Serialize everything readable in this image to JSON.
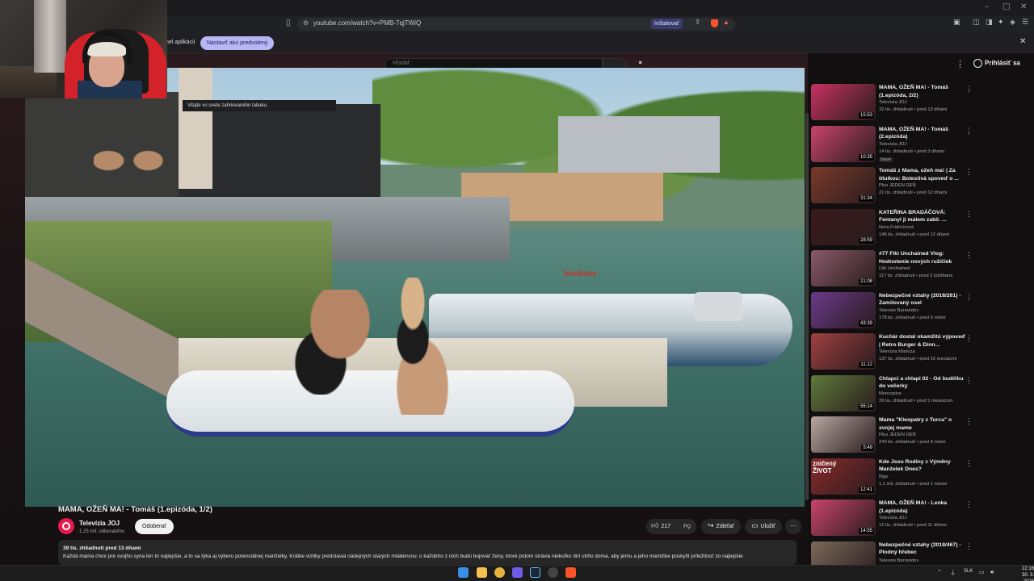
{
  "browser": {
    "url": "youtube.com/watch?v=PMB-7qjTWiQ",
    "install_label": "Inštalovať",
    "infobar_text": "nel aplikácií",
    "default_button": "Nastaviť ako predvolený",
    "close_glyph": "✕"
  },
  "youtube": {
    "search_placeholder": "Hľadať",
    "signin_label": "Prihlásiť sa"
  },
  "video": {
    "sign_text": "Vitajte vo svete zahrievaného tabaku.",
    "boat_text": "honkave",
    "title": "MAMA, OŽEŇ MA! - Tomáš (1.epizóda, 1/2)",
    "channel": "Televízia JOJ",
    "subscribers": "1,25 mil. odberateľov",
    "subscribe_label": "Odoberať",
    "likes": "217",
    "share_label": "Zdieľať",
    "save_label": "Uložiť",
    "stats": "39 tis. zhliadnutí  pred 13 dňami",
    "description": "Každá mama chce pre svojho syna len to najlepšie, a to sa týka aj výberu potenciálnej manželky. Krátke vizitky predstavia nádejných starých mládencov, o každého z nich budú bojovať ženy, ktoré potom strávia niekoľko dní uhňo doma, aby jemu a jeho mamičke poskytli príležitosť zo najlepšie"
  },
  "sidebar": {
    "items": [
      {
        "title": "MAMA, OŽEŇ MA! - Tomáš (1.epizóda, 2/2)",
        "channel": "Televízia JOJ",
        "meta": "32 tis. zhliadnutí • pred 13 dňami",
        "duration": "15:53",
        "badge": "",
        "thumb": "#c83262"
      },
      {
        "title": "MAMA, OŽEŇ MA! - Tomáš (2.epizóda)",
        "channel": "Televízia JOJ",
        "meta": "14 tis. zhliadnutí • pred 3 dňami",
        "duration": "10:35",
        "badge": "Nové",
        "thumb": "#c9446c"
      },
      {
        "title": "Tomáš z Mama, ožeň ma! | Za titulkou: Bolestivá spoveď o ...",
        "channel": "Plus JEDEN DEŇ",
        "meta": "21 tis. zhliadnutí • pred 12 dňami",
        "duration": "31:34",
        "badge": "",
        "thumb": "#7a3a2a"
      },
      {
        "title": "KATEŘINA BRADÁČOVÁ: Fentanyl ji málem zabil. ...",
        "channel": "Nora Fridrichová",
        "meta": "146 tis. zhliadnutí • pred 12 dňami",
        "duration": "28:59",
        "badge": "",
        "thumb": "#3a1a1a"
      },
      {
        "title": "#77 Fiki Unchained Vlog: Hodnotenie nových ružičiek",
        "channel": "Fiki Unchained",
        "meta": "117 tis. zhliadnutí • pred 2 týždňami",
        "duration": "21:08",
        "badge": "",
        "thumb": "#8a5a6a"
      },
      {
        "title": "Nebezpečné vztahy (2018/261) - Zamilovaný osel",
        "channel": "Televize Barrandov",
        "meta": "178 tis. zhliadnutí • pred 5 rokmi",
        "duration": "43:39",
        "badge": "",
        "thumb": "#6a3a8a"
      },
      {
        "title": "Kuchár dostal okamžitú výpoveď | Retro Burger & Dinn...",
        "channel": "Televízia Markíza",
        "meta": "137 tis. zhliadnutí • pred 10 mesiacmi",
        "duration": "11:12",
        "badge": "",
        "thumb": "#a04040"
      },
      {
        "title": "Chlapci a chlapi 02 - Od budíčku do večerky",
        "channel": "Moncopice",
        "meta": "39 tis. zhliadnutí • pred 1 mesiacom",
        "duration": "55:14",
        "badge": "",
        "thumb": "#5f7a3a"
      },
      {
        "title": "Mama \"Kleopatry z Turca\" o svojej mame",
        "channel": "Plus JEDEN DEŇ",
        "meta": "243 tis. zhliadnutí • pred 9 rokmi",
        "duration": "5:49",
        "badge": "",
        "thumb": "#b8a8a0"
      },
      {
        "title": "Kde Jsou Rodiny z Výměny Manželek Dnes?",
        "channel": "Bige",
        "meta": "1,1 mil. zhliadnutí • pred 1 rokom",
        "duration": "12:41",
        "badge": "",
        "thumb": "#8a2a2a",
        "overlay": "zničený ŽIVOT"
      },
      {
        "title": "MAMA, OŽEŇ MA! - Lenka (1.epizóda)",
        "channel": "Televízia JOJ",
        "meta": "12 tis. zhliadnutí • pred 11 dňami",
        "duration": "14:55",
        "badge": "",
        "thumb": "#c9446c"
      },
      {
        "title": "Nebezpečné vztahy (2018/467) - Plodný hřebec",
        "channel": "Televize Barrandov",
        "meta": "",
        "duration": "",
        "badge": "",
        "thumb": "#7a6a5a"
      }
    ]
  },
  "taskbar": {
    "lang": "SLK",
    "time": "22:16",
    "date": "30. 3. 2026"
  },
  "colors": {
    "accent_red": "#e5194a",
    "page_bg": "#0f0f0f"
  }
}
